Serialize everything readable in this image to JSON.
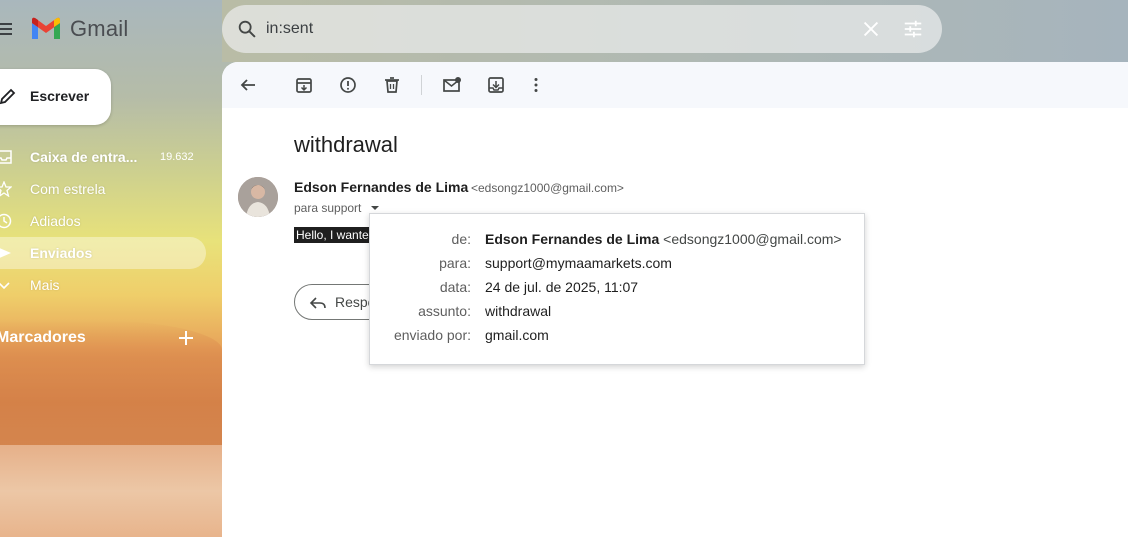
{
  "app": {
    "name": "Gmail"
  },
  "search": {
    "value": "in:sent"
  },
  "compose": {
    "label": "Escrever"
  },
  "nav": {
    "items": [
      {
        "label": "Caixa de entra...",
        "count": "19.632",
        "bold": true,
        "icon": "inbox-icon"
      },
      {
        "label": "Com estrela",
        "icon": "star-icon"
      },
      {
        "label": "Adiados",
        "icon": "clock-icon"
      },
      {
        "label": "Enviados",
        "icon": "send-icon",
        "bold": true,
        "active": true
      },
      {
        "label": "Mais",
        "icon": "chevron-down-icon"
      }
    ],
    "labels_heading": "Marcadores"
  },
  "email": {
    "subject": "withdrawal",
    "sender_name": "Edson Fernandes de Lima",
    "sender_email": "<edsongz1000@gmail.com>",
    "to_line": "para support",
    "snippet": "Hello, I wante",
    "reply_label": "Respo"
  },
  "details": {
    "from_key": "de:",
    "from_name": "Edson Fernandes de Lima",
    "from_email": "<edsongz1000@gmail.com>",
    "to_key": "para:",
    "to_value": "support@mymaamarkets.com",
    "date_key": "data:",
    "date_value": "24 de jul. de 2025, 11:07",
    "subject_key": "assunto:",
    "subject_value": "withdrawal",
    "sent_by_key": "enviado por:",
    "sent_by_value": "gmail.com"
  },
  "colors": {
    "brand_red": "#ea4335",
    "brand_blue": "#4285f4",
    "brand_green": "#34a853",
    "brand_yellow": "#fbbc04"
  }
}
